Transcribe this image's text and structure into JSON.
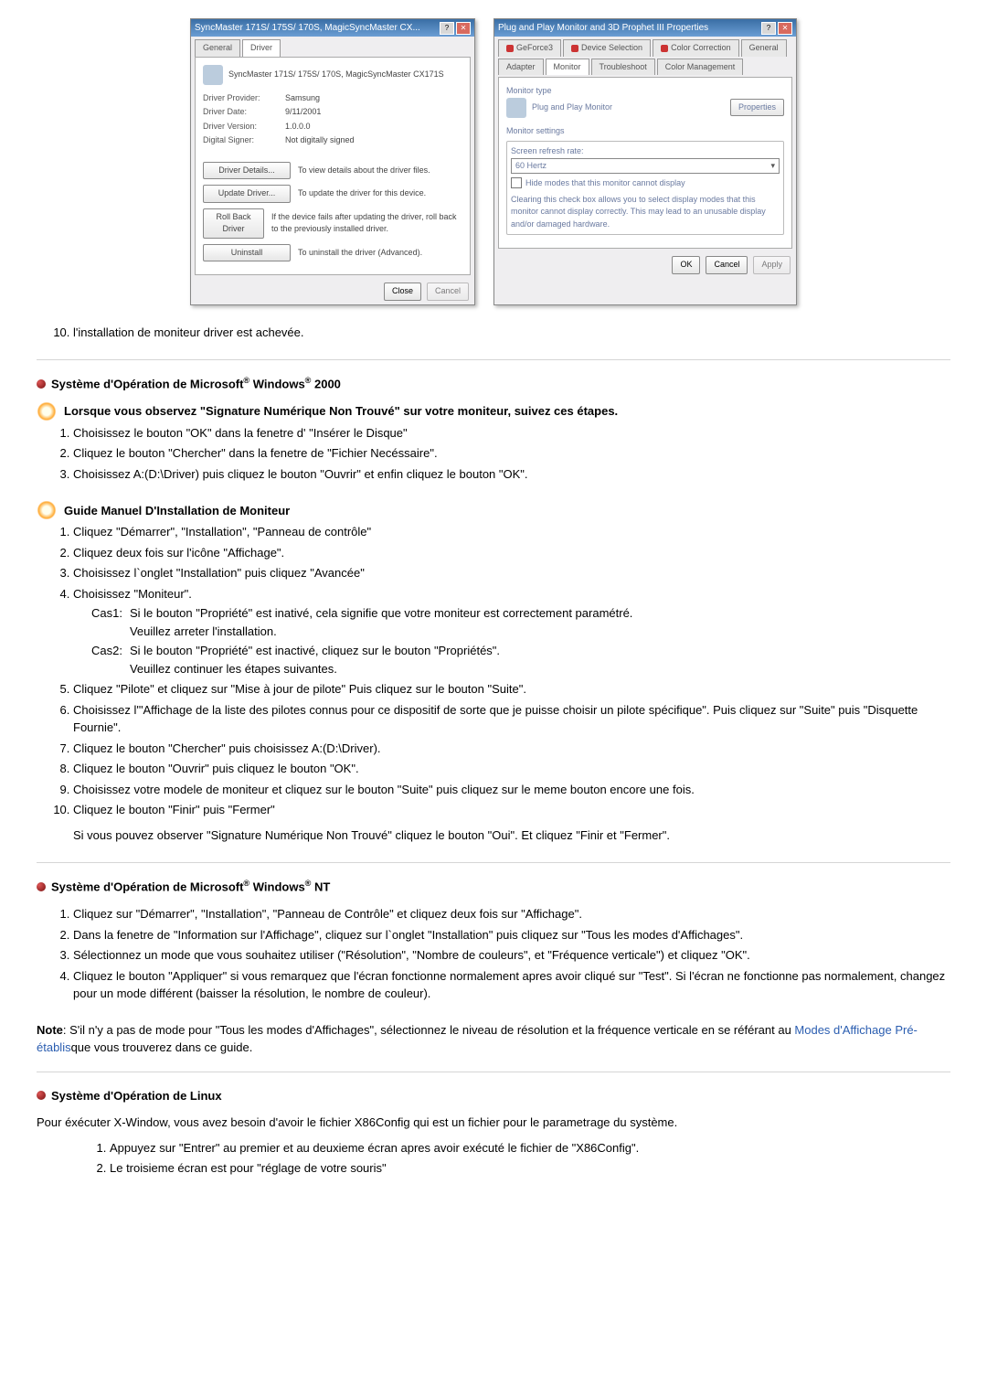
{
  "dlg1": {
    "title": "SyncMaster 171S/ 175S/ 170S, MagicSyncMaster CX...",
    "tabs": [
      "General",
      "Driver"
    ],
    "header": "SyncMaster 171S/ 175S/ 170S, MagicSyncMaster CX171S",
    "kv": {
      "provider_k": "Driver Provider:",
      "provider_v": "Samsung",
      "date_k": "Driver Date:",
      "date_v": "9/11/2001",
      "version_k": "Driver Version:",
      "version_v": "1.0.0.0",
      "signer_k": "Digital Signer:",
      "signer_v": "Not digitally signed"
    },
    "rows": {
      "details_btn": "Driver Details...",
      "details_txt": "To view details about the driver files.",
      "update_btn": "Update Driver...",
      "update_txt": "To update the driver for this device.",
      "rollback_btn": "Roll Back Driver",
      "rollback_txt": "If the device fails after updating the driver, roll back to the previously installed driver.",
      "uninstall_btn": "Uninstall",
      "uninstall_txt": "To uninstall the driver (Advanced)."
    },
    "close": "Close",
    "cancel": "Cancel"
  },
  "dlg2": {
    "title": "Plug and Play Monitor and 3D Prophet III Properties",
    "tabs": {
      "t1": "GeForce3",
      "t2": "Device Selection",
      "t3": "Color Correction",
      "t4": "General",
      "t5": "Adapter",
      "t6": "Monitor",
      "t7": "Troubleshoot",
      "t8": "Color Management"
    },
    "montype_lbl": "Monitor type",
    "montype_val": "Plug and Play Monitor",
    "props_btn": "Properties",
    "monset_lbl": "Monitor settings",
    "refresh_lbl": "Screen refresh rate:",
    "refresh_val": "60 Hertz",
    "hide_cb": "Hide modes that this monitor cannot display",
    "hide_desc": "Clearing this check box allows you to select display modes that this monitor cannot display correctly. This may lead to an unusable display and/or damaged hardware.",
    "ok": "OK",
    "cancel": "Cancel",
    "apply": "Apply"
  },
  "step10": {
    "item": "l'installation de moniteur driver est achevée."
  },
  "win2k": {
    "title_a": "Système d'Opération de Microsoft",
    "title_b": " Windows",
    "title_c": " 2000",
    "sig_head": "Lorsque vous observez \"Signature Numérique Non Trouvé\" sur votre moniteur, suivez ces étapes.",
    "sig": {
      "i1": "Choisissez le bouton \"OK\" dans la fenetre d' \"Insérer le Disque\"",
      "i2": "Cliquez le bouton \"Chercher\" dans la fenetre de \"Fichier Necéssaire\".",
      "i3": "Choisissez A:(D:\\Driver) puis cliquez le bouton \"Ouvrir\" et enfin cliquez le bouton \"OK\"."
    },
    "guide_head": "Guide Manuel D'Installation de Moniteur",
    "guide": {
      "i1": "Cliquez \"Démarrer\", \"Installation\", \"Panneau de contrôle\"",
      "i2": "Cliquez deux fois sur l'icône \"Affichage\".",
      "i3": "Choisissez l`onglet \"Installation\" puis cliquez \"Avancée\"",
      "i4": "Choisissez \"Moniteur\".",
      "c1_l": "Cas1:",
      "c1_a": "Si le bouton \"Propriété\" est inativé, cela signifie que votre moniteur est correctement paramétré.",
      "c1_b": "Veuillez arreter l'installation.",
      "c2_l": "Cas2:",
      "c2_a": "Si le bouton \"Propriété\" est inactivé, cliquez sur le bouton \"Propriétés\".",
      "c2_b": "Veuillez continuer les étapes suivantes.",
      "i5": "Cliquez \"Pilote\" et cliquez sur \"Mise à jour de pilote\" Puis cliquez sur le bouton \"Suite\".",
      "i6": "Choisissez l'\"Affichage de la liste des pilotes connus pour ce dispositif de sorte que je puisse choisir un pilote spécifique\". Puis cliquez sur \"Suite\" puis \"Disquette Fournie\".",
      "i7": "Cliquez le bouton \"Chercher\" puis choisissez A:(D:\\Driver).",
      "i8": "Cliquez le bouton \"Ouvrir\" puis cliquez le bouton \"OK\".",
      "i9": "Choisissez votre modele de moniteur et cliquez sur le bouton \"Suite\" puis cliquez sur le meme bouton encore une fois.",
      "i10": "Cliquez le bouton \"Finir\" puis \"Fermer\""
    },
    "sig_tail": "Si vous pouvez observer \"Signature Numérique Non Trouvé\" cliquez le bouton \"Oui\". Et cliquez \"Finir et \"Fermer\"."
  },
  "winnt": {
    "title_a": "Système d'Opération de Microsoft",
    "title_b": " Windows",
    "title_c": " NT",
    "items": {
      "i1": "Cliquez sur \"Démarrer\", \"Installation\", \"Panneau de Contrôle\" et cliquez deux fois sur \"Affichage\".",
      "i2": "Dans la fenetre de \"Information sur l'Affichage\", cliquez sur l`onglet \"Installation\" puis cliquez sur \"Tous les modes d'Affichages\".",
      "i3": "Sélectionnez un mode que vous souhaitez utiliser (\"Résolution\", \"Nombre de couleurs\", et \"Fréquence verticale\") et cliquez \"OK\".",
      "i4": "Cliquez le bouton \"Appliquer\" si vous remarquez que l'écran fonctionne normalement apres avoir cliqué sur \"Test\". Si l'écran ne fonctionne pas normalement, changez pour un mode différent (baisser la résolution, le nombre de couleur)."
    },
    "note_lead": "Note",
    "note_body": ": S'il n'y a pas de mode pour \"Tous les modes d'Affichages\", sélectionnez le niveau de résolution et la fréquence verticale en se référant au ",
    "note_link": "Modes d'Affichage Pré-établis",
    "note_tail": "que vous trouverez dans ce guide."
  },
  "linux": {
    "title": "Système d'Opération de Linux",
    "intro": "Pour éxécuter X-Window, vous avez besoin d'avoir le fichier X86Config qui est un fichier pour le parametrage du système.",
    "items": {
      "i1": "Appuyez sur \"Entrer\" au premier et au deuxieme écran apres avoir exécuté le fichier de \"X86Config\".",
      "i2": "Le troisieme écran est pour \"réglage de votre souris\""
    }
  }
}
